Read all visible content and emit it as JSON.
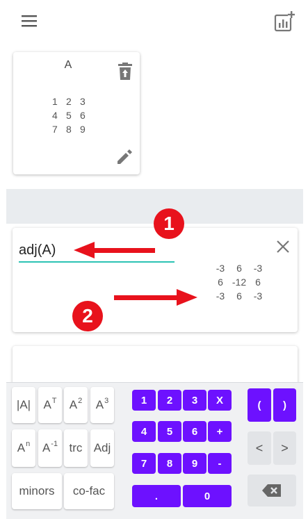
{
  "header": {
    "menu_icon": "hamburger-menu-icon",
    "add_icon": "add-chart-icon"
  },
  "matrix_card": {
    "name": "A",
    "rows": [
      [
        "1",
        "2",
        "3"
      ],
      [
        "4",
        "5",
        "6"
      ],
      [
        "7",
        "8",
        "9"
      ]
    ],
    "delete_icon": "delete-icon",
    "edit_icon": "pencil-icon"
  },
  "result_card": {
    "expression": "adj(A)",
    "close_icon": "close-icon",
    "rows": [
      [
        "-3",
        "6",
        "-3"
      ],
      [
        "6",
        "-12",
        "6"
      ],
      [
        "-3",
        "6",
        "-3"
      ]
    ]
  },
  "annotations": {
    "badge_1": "1",
    "badge_2": "2",
    "color": "#e8121c"
  },
  "keyboard": {
    "functions": {
      "det": "|A|",
      "transpose_base": "A",
      "transpose_sup": "T",
      "square_base": "A",
      "square_sup": "2",
      "cube_base": "A",
      "cube_sup": "3",
      "power_base": "A",
      "power_sup": "n",
      "inverse_base": "A",
      "inverse_sup": "-1",
      "trace": "trc",
      "adjoint": "Adj",
      "minors": "minors",
      "cofactor": "co-fac"
    },
    "numpad": {
      "k1": "1",
      "k2": "2",
      "k3": "3",
      "times": "X",
      "k4": "4",
      "k5": "5",
      "k6": "6",
      "plus": "+",
      "k7": "7",
      "k8": "8",
      "k9": "9",
      "minus": "-",
      "dot": ".",
      "k0": "0"
    },
    "nav": {
      "open_paren": "(",
      "close_paren": ")",
      "left": "<",
      "right": ">",
      "backspace_icon": "backspace-icon"
    }
  },
  "colors": {
    "accent_purple": "#6d11ff",
    "input_underline": "#2cc3b4",
    "annotation_red": "#e8121c"
  }
}
